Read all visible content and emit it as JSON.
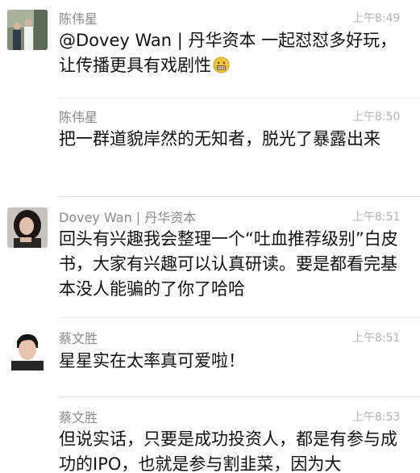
{
  "messages": [
    {
      "sender": "陈伟星",
      "time": "上午8:49",
      "text": "@Dovey Wan | 丹华资本 一起怼怼多好玩，让传播更具有戏剧性",
      "emoji": "grimacing-face",
      "avatar": "portrait-photo"
    },
    {
      "sender": "陈伟星",
      "time": "上午8:50",
      "text": "把一群道貌岸然的无知者，脱光了暴露出来"
    },
    {
      "sender": "Dovey Wan | 丹华资本",
      "time": "上午8:51",
      "text": "回头有兴趣我会整理一个“吐血推荐级别”白皮书，大家有兴趣可以认真研读。要是都看完基本没人能骗的了你了哈哈",
      "avatar": "portrait-photo"
    },
    {
      "sender": "蔡文胜",
      "time": "上午8:51",
      "text": "星星实在太率真可爱啦！",
      "avatar": "portrait-photo"
    },
    {
      "sender": "蔡文胜",
      "time": "上午8:53",
      "text": "但说实话，只要是成功投资人，都是有参与成功的IPO，也就是参与割韭菜，因为大"
    }
  ]
}
